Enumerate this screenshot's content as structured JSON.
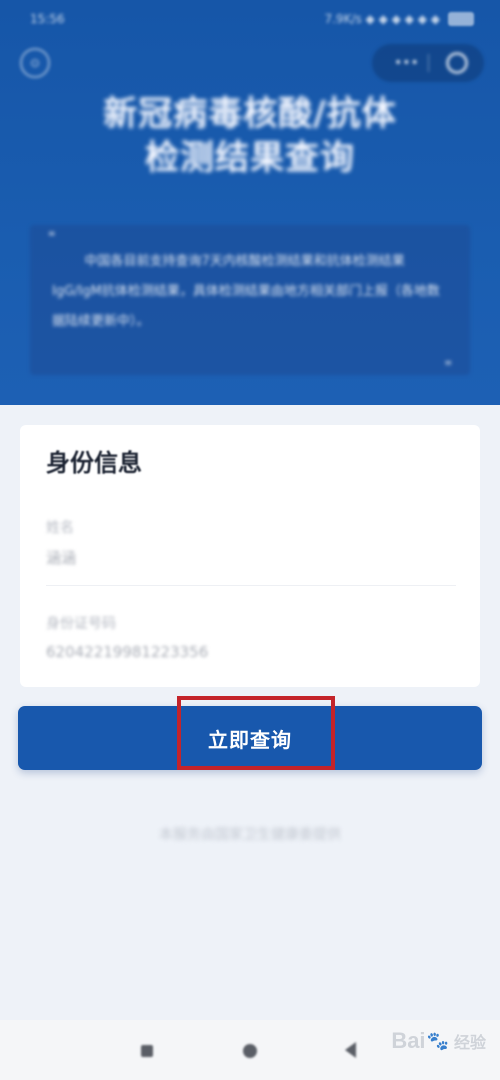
{
  "status_bar": {
    "time": "15:56",
    "icons_text": "7.9K/s ◆ ◆ ◆ ◆ ◆ ◆"
  },
  "header": {
    "left_icon": "⊙",
    "capsule_menu": "•••",
    "title_line1": "新冠病毒核酸/抗体",
    "title_line2": "检测结果查询",
    "notice_text": "中国各目前支持查询7天内核酸检测结果和抗体检测结果IgG/IgM抗体检测结果，具体检测结果由地方相关部门上报（各地数据陆续更新中）。",
    "quote_open": "❝",
    "quote_close": "❞"
  },
  "card": {
    "title": "身份信息",
    "name_label": "姓名",
    "name_value": "涵涵",
    "id_label": "身份证号码",
    "id_value": "62042219981223356"
  },
  "query_button": {
    "label": "立即查询"
  },
  "footer_note": "本服务由国家卫生健康委提供",
  "watermark": {
    "text_left": "Bai",
    "text_right": "经验",
    "paw": "🐾"
  },
  "colors": {
    "header_bg": "#1a5db0",
    "button_bg": "#1858ad",
    "highlight": "#c4242a",
    "page_bg": "#eef2f8"
  }
}
